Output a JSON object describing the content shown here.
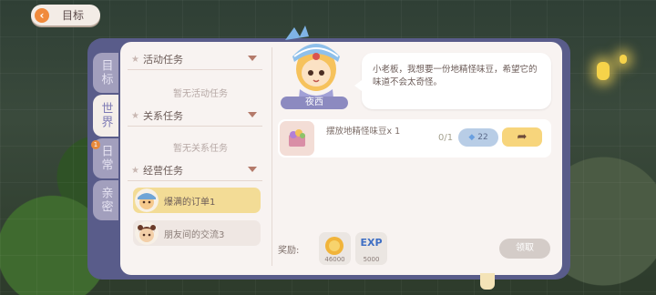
{
  "nav": {
    "back_label": "目标"
  },
  "tabs": [
    {
      "label": "目标",
      "active": false
    },
    {
      "label": "世界",
      "active": true
    },
    {
      "label": "日常",
      "active": false,
      "badge": "1"
    },
    {
      "label": "亲密",
      "active": false
    }
  ],
  "sections": [
    {
      "title": "活动任务",
      "empty_text": "暂无活动任务"
    },
    {
      "title": "关系任务",
      "empty_text": "暂无关系任务"
    },
    {
      "title": "经营任务",
      "tasks": [
        "爆满的订单1",
        "朋友间的交流3"
      ]
    }
  ],
  "npc": {
    "name": "夜西",
    "dialogue": "小老板，我想要一份地精怪味豆，希望它的味道不会太奇怪。"
  },
  "objective": {
    "text": "摆放地精怪味豆x 1",
    "progress": "0/1",
    "gem_cost": "22"
  },
  "rewards": {
    "label": "奖励:",
    "items": [
      {
        "icon": "coin-icon",
        "amount": "46000"
      },
      {
        "icon": "exp-icon",
        "label": "EXP",
        "amount": "5000"
      }
    ],
    "claim_label": "领取"
  },
  "colors": {
    "frame": "#595c8a",
    "accent": "#f08a3c",
    "selected": "#f3dc96"
  }
}
